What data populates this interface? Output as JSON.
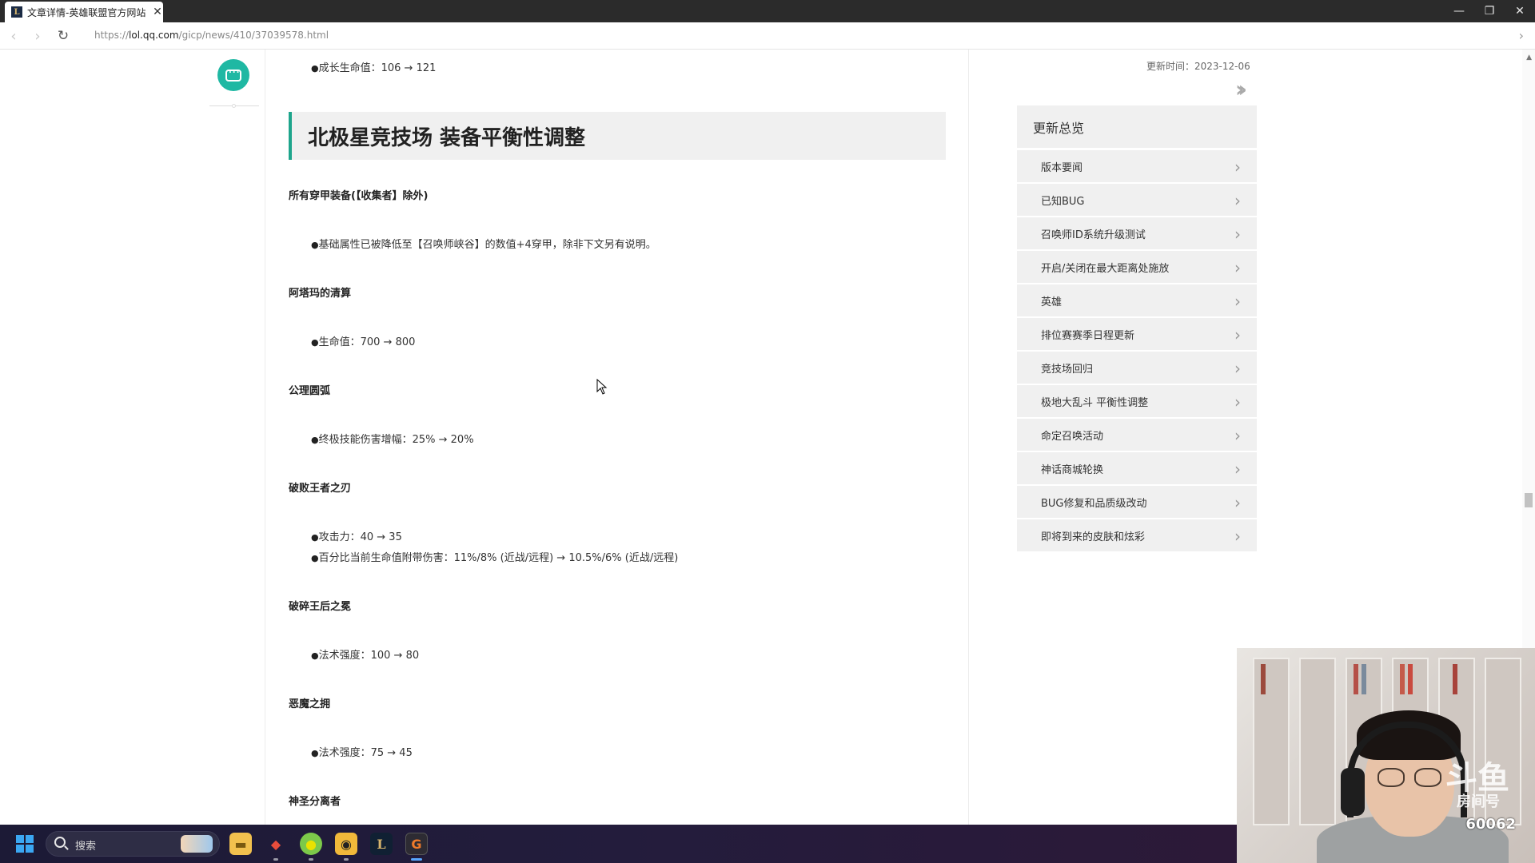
{
  "browser": {
    "tab_title": "文章详情-英雄联盟官方网站",
    "tab_favicon": "L",
    "url_prefix": "https://",
    "url_host": "lol.qq.com",
    "url_path": "/gicp/news/410/37039578.html"
  },
  "article": {
    "top_bullet": "成长生命值：106 → 121",
    "section_heading": "北极星竞技场 装备平衡性调整",
    "blocks": [
      {
        "title": "所有穿甲装备(【收集者】除外)",
        "bullets": [
          "基础属性已被降低至【召唤师峡谷】的数值+4穿甲，除非下文另有说明。"
        ]
      },
      {
        "title": "阿塔玛的清算",
        "bullets": [
          "生命值：700 → 800"
        ]
      },
      {
        "title": "公理圆弧",
        "bullets": [
          "终极技能伤害增幅：25% → 20%"
        ]
      },
      {
        "title": "破败王者之刃",
        "bullets": [
          "攻击力：40 → 35",
          "百分比当前生命值附带伤害：11%/8% (近战/远程) → 10.5%/6% (近战/远程)"
        ]
      },
      {
        "title": "破碎王后之冕",
        "bullets": [
          "法术强度：100 → 80"
        ]
      },
      {
        "title": "恶魔之拥",
        "bullets": [
          "法术强度：75 → 45"
        ]
      },
      {
        "title": "神圣分离者",
        "bullets": []
      }
    ]
  },
  "sidebar": {
    "update_time": "更新时间：2023-12-06",
    "summary_title": "更新总览",
    "items": [
      "版本要闻",
      "已知BUG",
      "召唤师ID系统升级测试",
      "开启/关闭在最大距离处施放",
      "英雄",
      "排位赛赛季日程更新",
      "竞技场回归",
      "极地大乱斗 平衡性调整",
      "命定召唤活动",
      "神话商城轮换",
      "BUG修复和品质级改动",
      "即将到来的皮肤和炫彩"
    ]
  },
  "taskbar": {
    "search_placeholder": "搜索"
  },
  "webcam": {
    "watermark_label": "房间号",
    "room_number": "60062"
  },
  "colors": {
    "accent_teal": "#1ea58c",
    "chat_button": "#1fb8a3"
  }
}
